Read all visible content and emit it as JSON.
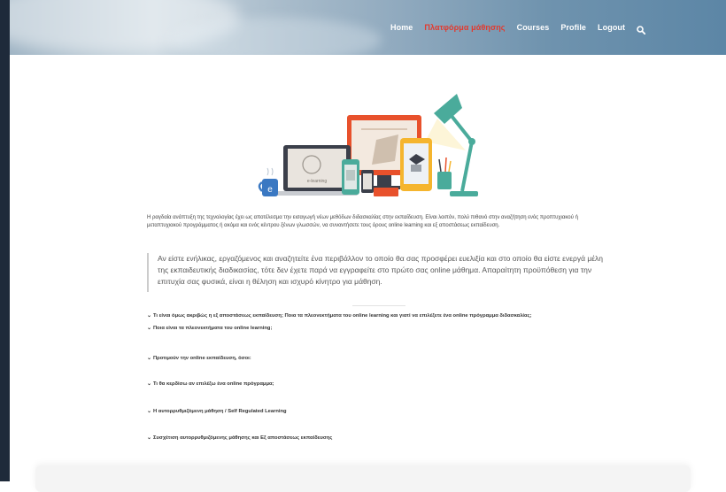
{
  "nav": {
    "items": [
      {
        "label": "Home",
        "active": false
      },
      {
        "label": "Πλατφόρμα μάθησης",
        "active": true
      },
      {
        "label": "Courses",
        "active": false
      },
      {
        "label": "Profile",
        "active": false
      },
      {
        "label": "Logout",
        "active": false
      }
    ],
    "search_icon": "search-icon",
    "active_color": "#e23a2f"
  },
  "content": {
    "intro": "Η ραγδαία ανάπτυξη της τεχνολογίας έχει ως αποτέλεσμα την εισαγωγή νέων μεθόδων διδασκαλίας στην εκπαίδευση. Είναι λοιπόν, πολύ πιθανό στην αναζήτηση ενός προπτυχιακού ή μεταπτυχιακού προγράμματος ή ακόμα και ενός κέντρου ξένων γλωσσών, να συναντήσετε τους όρους online learning και εξ αποστάσεως εκπαίδευση.",
    "quote": "Αν είστε ενήλικας, εργαζόμενος και αναζητείτε ένα περιβάλλον το οποίο θα σας προσφέρει ευελιξία και στο οποίο θα είστε ενεργά μέλη της εκπαιδευτικής διαδικασίας, τότε δεν έχετε παρά να εγγραφείτε στο πρώτο σας online μάθημα. Απαραίτητη προϋπόθεση για την επιτυχία σας φυσικά, είναι η θέληση και ισχυρό κίνητρο για μάθηση.",
    "faq": [
      "Τι είναι όμως ακριβώς η εξ αποστάσεως εκπαίδευση; Ποια τα πλεονεκτήματα του online learning και γιατί να επιλέξετε ένα online πρόγραμμα διδασκαλίας;",
      "Ποια είναι τα πλεονεκτήματα του online learning;",
      "Προτιμούν την online εκπαίδευση, όσοι:",
      "Τι θα κερδίσω αν επιλέξω ένα online πρόγραμμα;",
      "Η αυτορρυθμιζόμενη μάθηση / Self Regulated Learning",
      "Συσχέτιση αυτορρυθμιζόμενης μάθησης και Εξ αποστάσεως εκπαίδευσης"
    ]
  },
  "hero_labels": {
    "laptop_screen": "e-learning"
  },
  "colors": {
    "orange": "#e8512c",
    "teal": "#4aab9b",
    "yellow": "#f5b52e",
    "dark": "#3b3f4a",
    "blue": "#3a78c2"
  }
}
